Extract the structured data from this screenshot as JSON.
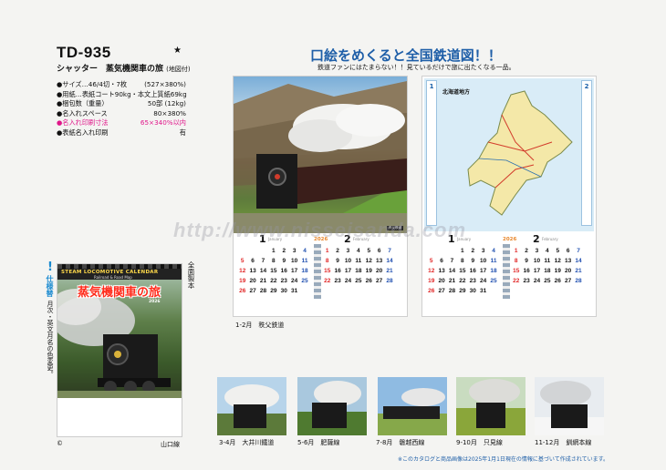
{
  "product": {
    "code": "TD-935",
    "star": "★",
    "name": "シャッター　蒸気機関車の旅",
    "name_sub": "(地図付)"
  },
  "specs": [
    {
      "label": "●サイズ…46/4切・7枚",
      "value": "(527×380%)",
      "highlight": false
    },
    {
      "label": "●用紙…表紙コート90kg・本文上質紙69kg",
      "value": "",
      "highlight": false
    },
    {
      "label": "●梱包数（重量）",
      "value": "50部 (12kg)",
      "highlight": false
    },
    {
      "label": "●名入れスペース",
      "value": "80×380%",
      "highlight": false
    },
    {
      "label": "●名入れ印刷寸法",
      "value": "65×340%以内",
      "highlight": true
    },
    {
      "label": "●表紙名入れ印刷",
      "value": "有",
      "highlight": false
    }
  ],
  "side_banner": {
    "mark": "!",
    "tag": "仕様替",
    "note": "月次・英文月名の色変更。"
  },
  "cover": {
    "strip_text": "STEAM LOCOMOTIVE CALENDAR",
    "strip_sub": "Railroad & Road Map",
    "title": "蒸気機関車の旅",
    "year": "2026",
    "copyright": "©",
    "caption": "山口線",
    "binding": "全面製本"
  },
  "headline": "口絵をめくると全国鉄道図！！",
  "tagline": "鉄道ファンにはたまらない！！見ているだけで旅に出たくなる一品。",
  "pages": {
    "left": {
      "photo_label": "秩父鉄道",
      "caption": "1-2月　秩父鉄道"
    },
    "right": {
      "map_title": "北海道地方",
      "side_left": "1",
      "side_right": "2"
    }
  },
  "calendar": {
    "year_label": "2026",
    "months": [
      {
        "num": "1",
        "en": "January",
        "days": [
          "",
          "",
          "",
          "1",
          "2",
          "3",
          "4",
          "5",
          "6",
          "7",
          "8",
          "9",
          "10",
          "11",
          "12",
          "13",
          "14",
          "15",
          "16",
          "17",
          "18",
          "19",
          "20",
          "21",
          "22",
          "23",
          "24",
          "25",
          "26",
          "27",
          "28",
          "29",
          "30",
          "31"
        ]
      },
      {
        "num": "2",
        "en": "February",
        "days": [
          "1",
          "2",
          "3",
          "4",
          "5",
          "6",
          "7",
          "8",
          "9",
          "10",
          "11",
          "12",
          "13",
          "14",
          "15",
          "16",
          "17",
          "18",
          "19",
          "20",
          "21",
          "22",
          "23",
          "24",
          "25",
          "26",
          "27",
          "28"
        ]
      }
    ]
  },
  "watermark": "http://www.nisseisanda.com",
  "thumbnails": [
    {
      "caption": "3-4月　大井川鐵道"
    },
    {
      "caption": "5-6月　肥薩線"
    },
    {
      "caption": "7-8月　磐越西線"
    },
    {
      "caption": "9-10月　只見線"
    },
    {
      "caption": "11-12月　釧網本線"
    }
  ],
  "footnote": "※このカタログと商品画像は2025年1月1日現在の情報に基づいて作成されています。"
}
